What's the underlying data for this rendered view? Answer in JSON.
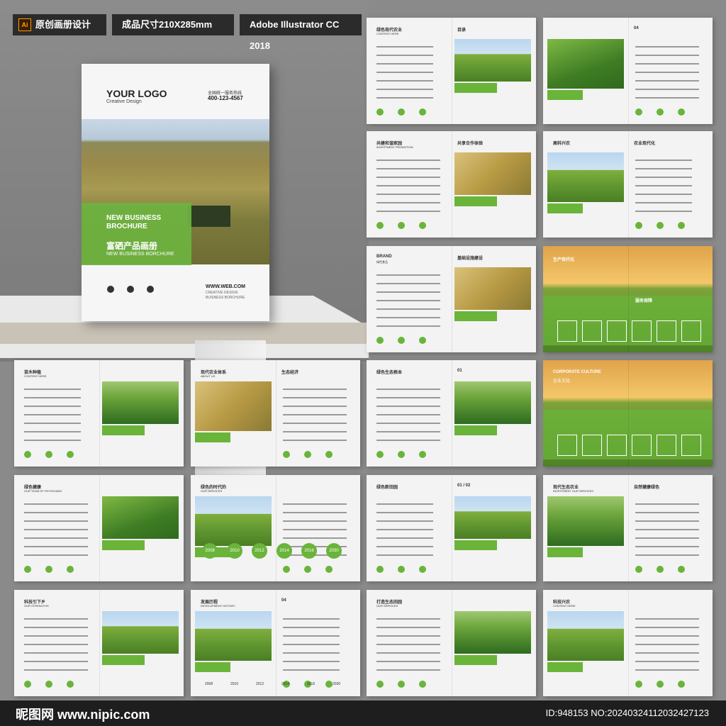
{
  "header": {
    "ai_badge": "Ai",
    "tag1": "原创画册设计",
    "tag2": "成品尺寸210X285mm",
    "tag3": "Adobe Illustrator CC 2018"
  },
  "cover": {
    "logo": "YOUR LOGO",
    "logo_sub": "Creative Design",
    "hotline_label": "全国统一服务热线",
    "phone": "400-123-4567",
    "title_en": "NEW BUSINESS BROCHURE",
    "title_cn": "富硒产品画册",
    "title_en2": "NEW BUSINESS BORCHURE",
    "web": "WWW.WEB.COM",
    "web_sub1": "CREATIVE DESIGN",
    "web_sub2": "BUSINESS BORCHURE"
  },
  "spreads": [
    {
      "title": "绿色现代农业",
      "sub": "CONTENT HERE",
      "right": "目录"
    },
    {
      "title": "",
      "sub": "",
      "right": "04"
    },
    {
      "title": "共建和谐家园",
      "sub": "INVESTMENT PROMOTION",
      "right": "共享合作体验"
    },
    {
      "title": "高科兴农",
      "sub": "",
      "right": "农业现代化"
    },
    {
      "title": "BRAND",
      "sub": "绿色食品",
      "right": "基础设施建设"
    },
    {
      "title": "生产现代化",
      "sub": "",
      "right": "服务保障"
    },
    {
      "title": "苗木种植",
      "sub": "CONTENT HERE",
      "right": ""
    },
    {
      "title": "现代农业体系",
      "sub": "ABOUT US",
      "right": "生态经济"
    },
    {
      "title": "绿色生态根本",
      "sub": "",
      "right": "01"
    },
    {
      "title": "CORPORATE CULTURE",
      "sub": "企业文化",
      "right": ""
    },
    {
      "title": "绿色健康",
      "sub": "OUR TEAM OF PHYSICIANS",
      "right": ""
    },
    {
      "title": "绿色的时代的",
      "sub": "OUR SERVICES",
      "right": ""
    },
    {
      "title": "绿色新田园",
      "sub": "",
      "right": "01 / 02"
    },
    {
      "title": "现代生态农业",
      "sub": "INVESTMENT OUR SERVICES",
      "right": "自然健康绿色"
    },
    {
      "title": "科技引下乡",
      "sub": "OUR STRENGTHS",
      "right": ""
    },
    {
      "title": "发展历程",
      "sub": "DEVELOPMENT HISTORY",
      "right": "04"
    },
    {
      "title": "打造生态田园",
      "sub": "OUR SERVICES",
      "right": ""
    },
    {
      "title": "科技兴农",
      "sub": "CONTENT HERE",
      "right": ""
    }
  ],
  "years": [
    "2008",
    "2010",
    "2012",
    "2014",
    "2016",
    "2030"
  ],
  "footer": {
    "brand": "昵图网 www.nipic.com",
    "id": "ID:948153 NO:20240324112032427123"
  }
}
